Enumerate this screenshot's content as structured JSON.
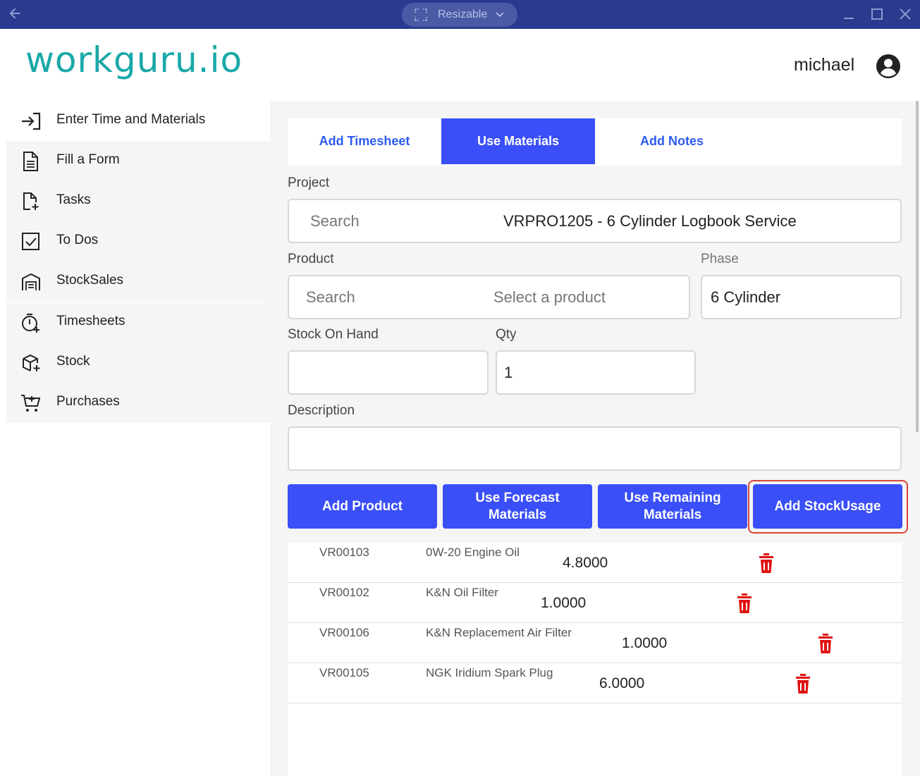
{
  "titlebar": {
    "window_mode": "Resizable",
    "back_icon": "arrow-left-icon",
    "minimize_icon": "minimize-icon",
    "maximize_icon": "maximize-icon",
    "close_icon": "close-icon"
  },
  "header": {
    "logo": "workguru.io",
    "logo_color": "#1aa8a8",
    "username": "michael",
    "avatar_icon": "account-circle-icon"
  },
  "sidebar": {
    "items": [
      {
        "label": "Enter Time and Materials",
        "icon": "login-arrow-icon",
        "active": true
      },
      {
        "label": "Fill a Form",
        "icon": "document-icon"
      },
      {
        "label": "Tasks",
        "icon": "file-plus-icon"
      },
      {
        "label": "To Dos",
        "icon": "checkbox-icon"
      },
      {
        "label": "StockSales",
        "icon": "warehouse-icon"
      },
      {
        "label": "Timesheets",
        "icon": "timer-plus-icon"
      },
      {
        "label": "Stock",
        "icon": "package-plus-icon"
      },
      {
        "label": "Purchases",
        "icon": "cart-plus-icon"
      }
    ]
  },
  "tabs": [
    {
      "label": "Add Timesheet"
    },
    {
      "label": "Use Materials",
      "active": true
    },
    {
      "label": "Add Notes"
    }
  ],
  "form": {
    "project_label": "Project",
    "project_placeholder": "Search",
    "project_value": "VRPRO1205 - 6 Cylinder Logbook Service",
    "product_label": "Product",
    "product_placeholder": "Search",
    "product_value": "Select a product",
    "phase_label": "Phase",
    "phase_value": "6 Cylinder",
    "stock_on_hand_label": "Stock On Hand",
    "stock_on_hand_value": "",
    "qty_label": "Qty",
    "qty_value": "1",
    "description_label": "Description",
    "description_value": ""
  },
  "buttons": {
    "add_product": "Add Product",
    "use_forecast": "Use Forecast Materials",
    "use_remaining": "Use Remaining Materials",
    "add_stock_usage": "Add StockUsage"
  },
  "materials": [
    {
      "code": "VR00103",
      "name": "0W-20 Engine Oil",
      "qty": "4.8000"
    },
    {
      "code": "VR00102",
      "name": "K&N Oil Filter",
      "qty": "1.0000"
    },
    {
      "code": "VR00106",
      "name": "K&N Replacement Air Filter",
      "qty": "1.0000"
    },
    {
      "code": "VR00105",
      "name": "NGK Iridium Spark Plug",
      "qty": "6.0000"
    }
  ],
  "colors": {
    "titlebar": "#2a3a8f",
    "primary": "#3a4ff7",
    "tab_text": "#2d5bf0",
    "delete": "#e01010",
    "focus": "#d9453a"
  }
}
